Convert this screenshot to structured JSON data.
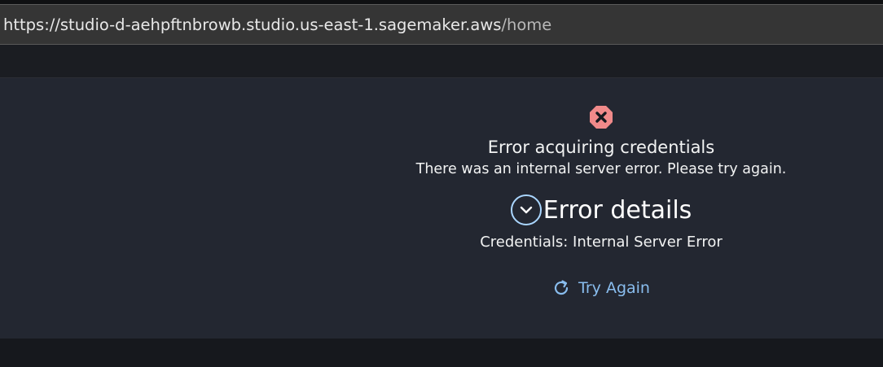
{
  "browser": {
    "url_origin": "https://studio-d-aehpftnbrowb.studio.us-east-1.sagemaker.aws",
    "url_path": "/home"
  },
  "error": {
    "icon": "error-x-icon",
    "title": "Error acquiring credentials",
    "message": "There was an internal server error. Please try again.",
    "details_heading": "Error details",
    "details_text": "Credentials: Internal Server Error",
    "retry_label": "Try Again",
    "retry_icon": "refresh-icon"
  },
  "colors": {
    "error_icon": "#f08a8a",
    "link": "#89bdee",
    "panel_bg": "#232731"
  }
}
